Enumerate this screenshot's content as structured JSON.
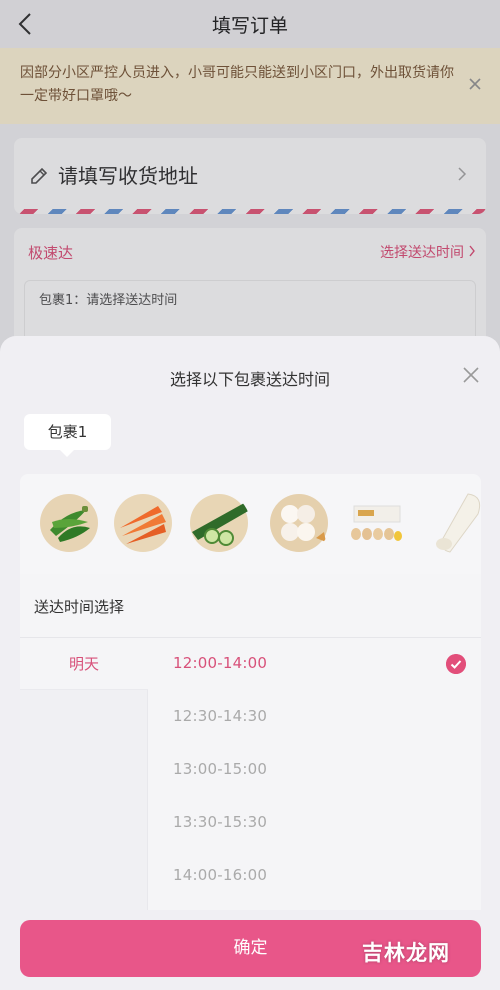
{
  "nav": {
    "title": "填写订单"
  },
  "notice": {
    "text": "因部分小区严控人员进入，小哥可能只能送到小区门口，外出取货请你一定带好口罩哦～"
  },
  "address": {
    "placeholder_label": "请填写收货地址"
  },
  "shipping": {
    "speed_label": "极速达",
    "select_time_label": "选择送达时间",
    "package_text": "包裹1：请选择送达时间"
  },
  "sheet": {
    "title": "选择以下包裹送达时间",
    "package_tab": "包裹1",
    "section_title": "送达时间选择",
    "products": [
      "green-pepper",
      "carrot",
      "cucumber",
      "garlic",
      "eggs",
      "white-radish"
    ],
    "days": [
      "明天"
    ],
    "slots": [
      "12:00-14:00",
      "12:30-14:30",
      "13:00-15:00",
      "13:30-15:30",
      "14:00-16:00"
    ],
    "selected_slot_index": 0,
    "confirm_label": "确定"
  },
  "watermark": "吉林龙网",
  "colors": {
    "accent": "#e85689",
    "accent_text": "#d8517a",
    "notice_bg": "#fff6d9"
  }
}
